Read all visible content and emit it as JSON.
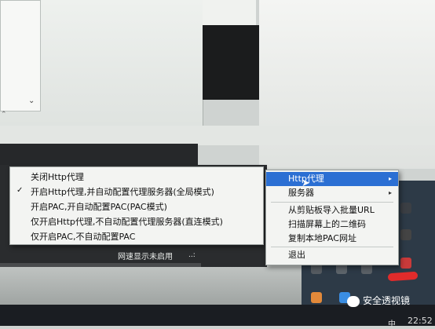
{
  "context_menu_left": {
    "items": [
      {
        "label": "关闭Http代理",
        "checked": false
      },
      {
        "label": "开启Http代理,并自动配置代理服务器(全局模式)",
        "checked": true
      },
      {
        "label": "开启PAC,开自动配置PAC(PAC模式)",
        "checked": false
      },
      {
        "label": "仅开启Http代理,不自动配置代理服务器(直连模式)",
        "checked": false
      },
      {
        "label": "仅开启PAC,不自动配置PAC",
        "checked": false
      }
    ],
    "check_glyph": "✓"
  },
  "context_menu_right": {
    "items": [
      {
        "label": "Http代理",
        "submenu": true,
        "highlighted": true
      },
      {
        "label": "服务器",
        "submenu": true,
        "highlighted": false
      },
      {
        "label": "从剪贴板导入批量URL",
        "submenu": false,
        "highlighted": false
      },
      {
        "label": "扫描屏幕上的二维码",
        "submenu": false,
        "highlighted": false
      },
      {
        "label": "复制本地PAC网址",
        "submenu": false,
        "highlighted": false
      },
      {
        "label": "退出",
        "submenu": false,
        "highlighted": false
      }
    ],
    "submenu_glyph": "▸",
    "highlight_color": "#2b6fd3"
  },
  "status": {
    "speed_label": "网速显示未启用",
    "speed_dots": "..:"
  },
  "watermark": {
    "text": "安全透视镜"
  },
  "taskbar": {
    "clock": "22:52",
    "ime": "中"
  },
  "colors": {
    "menu_bg": "#f3f4f2",
    "tray_bg": "#2d3a47",
    "mark_red": "#e02b2b"
  }
}
